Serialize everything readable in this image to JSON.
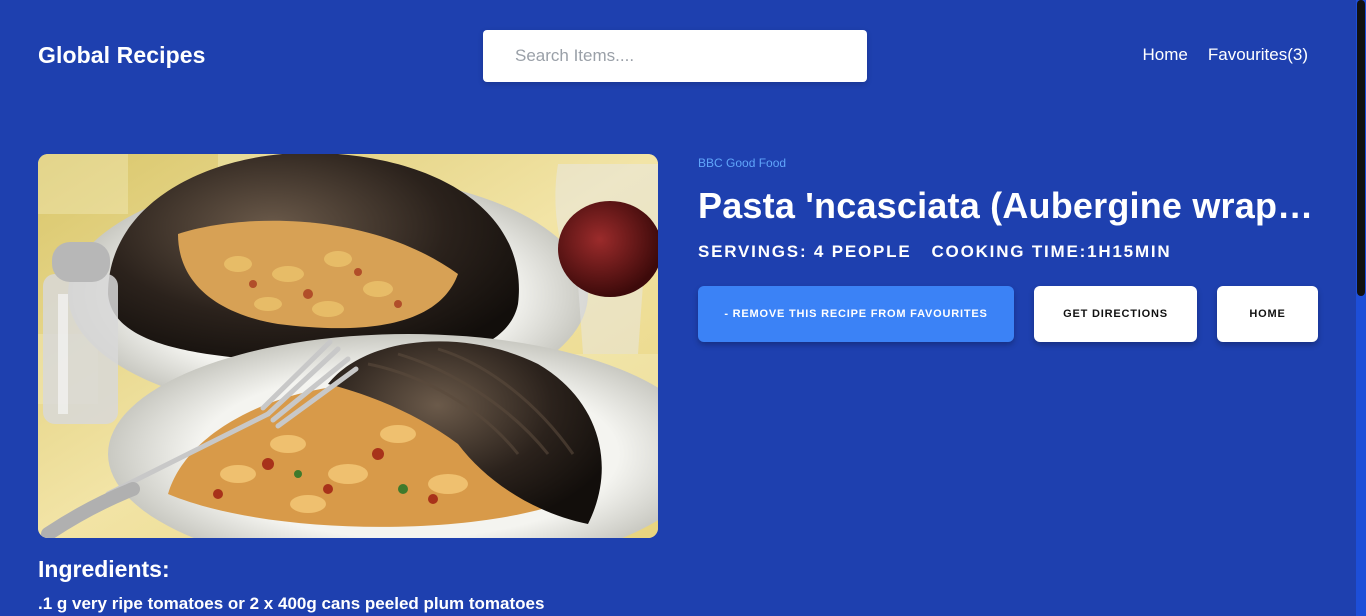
{
  "header": {
    "brand": "Global Recipes",
    "search_placeholder": "Search Items....",
    "nav": {
      "home": "Home",
      "favourites": "Favourites(3)"
    }
  },
  "recipe": {
    "publisher": "BBC Good Food",
    "title": "Pasta 'ncasciata (Aubergine wrap…",
    "servings": "SERVINGS: 4 PEOPLE",
    "cooking_time": "COOKING TIME:1H15MIN",
    "buttons": {
      "remove": "- Remove this recipe from favourites",
      "directions": "Get directions",
      "home": "Home"
    },
    "ingredients_title": "Ingredients:",
    "ingredients": [
      ".1 g very ripe tomatoes or 2 x 400g cans peeled plum tomatoes"
    ]
  },
  "colors": {
    "background": "#1e40af",
    "accent": "#3b82f6",
    "publisher": "#60a5fa"
  },
  "icons": {
    "image": "pasta-dish-photo"
  }
}
